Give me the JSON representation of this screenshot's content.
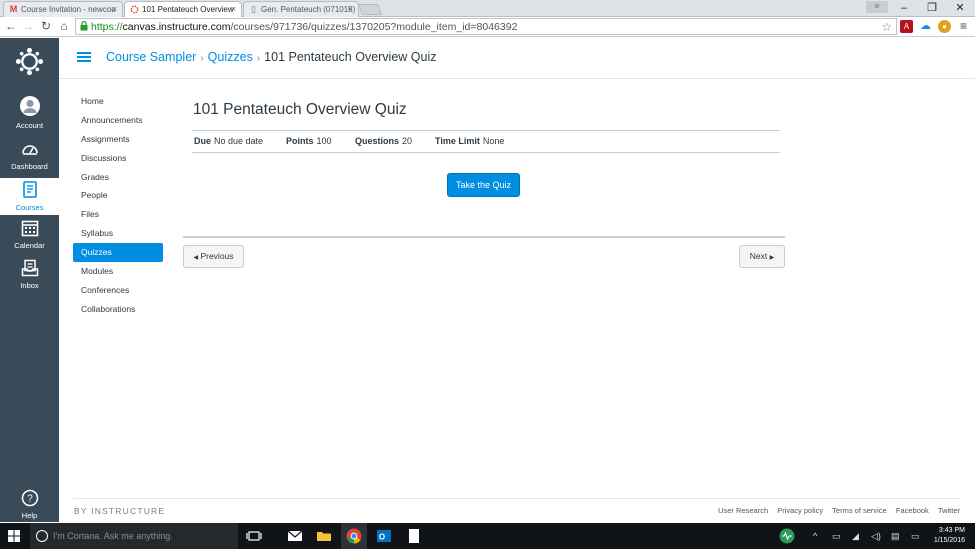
{
  "browser": {
    "tabs": [
      {
        "title": "Course Invitation - newcou",
        "icon": "gmail-icon",
        "active": false
      },
      {
        "title": "101 Pentateuch Overview",
        "icon": "canvas-icon",
        "active": true
      },
      {
        "title": "Gen. Pentateuch (071015)",
        "icon": "document-icon",
        "active": false
      }
    ],
    "url_scheme": "https://",
    "url_host": "canvas.instructure.com",
    "url_path": "/courses/971736/quizzes/1370205?module_item_id=8046392"
  },
  "global_nav": [
    {
      "label": "Account",
      "icon": "account-icon"
    },
    {
      "label": "Dashboard",
      "icon": "dashboard-icon"
    },
    {
      "label": "Courses",
      "icon": "courses-icon",
      "active": true
    },
    {
      "label": "Calendar",
      "icon": "calendar-icon"
    },
    {
      "label": "Inbox",
      "icon": "inbox-icon"
    },
    {
      "label": "Help",
      "icon": "help-icon"
    }
  ],
  "breadcrumb": {
    "course": "Course Sampler",
    "section": "Quizzes",
    "current": "101 Pentateuch Overview Quiz",
    "separator": "›"
  },
  "course_nav": [
    "Home",
    "Announcements",
    "Assignments",
    "Discussions",
    "Grades",
    "People",
    "Files",
    "Syllabus",
    "Quizzes",
    "Modules",
    "Conferences",
    "Collaborations"
  ],
  "course_nav_active": "Quizzes",
  "quiz": {
    "title": "101 Pentateuch Overview Quiz",
    "due_label": "Due",
    "due_value": "No due date",
    "points_label": "Points",
    "points_value": "100",
    "questions_label": "Questions",
    "questions_value": "20",
    "time_limit_label": "Time Limit",
    "time_limit_value": "None",
    "take_button": "Take the Quiz"
  },
  "pager": {
    "previous": "Previous",
    "next": "Next"
  },
  "footer": {
    "brand": "BY INSTRUCTURE",
    "links": [
      "User Research",
      "Privacy policy",
      "Terms of service",
      "Facebook",
      "Twitter"
    ]
  },
  "taskbar": {
    "search_placeholder": "I'm Cortana. Ask me anything.",
    "time": "3:43 PM",
    "date": "1/15/2016"
  },
  "colors": {
    "canvas_blue": "#008ee2",
    "nav_bg": "#394b58"
  }
}
